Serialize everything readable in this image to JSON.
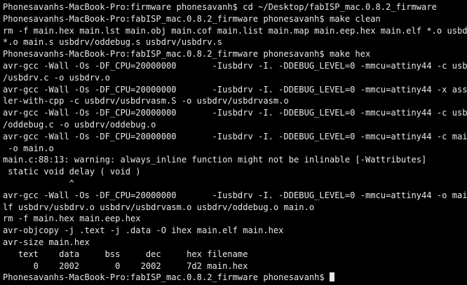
{
  "terminal": {
    "lines": [
      "Phonesavanhs-MacBook-Pro:firmware phonesavanh$ cd ~/Desktop/fabISP_mac.0.8.2_firmware",
      "Phonesavanhs-MacBook-Pro:fabISP_mac.0.8.2_firmware phonesavanh$ make clean",
      "rm -f main.hex main.lst main.obj main.cof main.list main.map main.eep.hex main.elf *.o usbdrv/",
      "*.o main.s usbdrv/oddebug.s usbdrv/usbdrv.s",
      "Phonesavanhs-MacBook-Pro:fabISP_mac.0.8.2_firmware phonesavanh$ make hex",
      "avr-gcc -Wall -Os -DF_CPU=20000000       -Iusbdrv -I. -DDEBUG_LEVEL=0 -mmcu=attiny44 -c usbdrv",
      "/usbdrv.c -o usbdrv.o",
      "avr-gcc -Wall -Os -DF_CPU=20000000       -Iusbdrv -I. -DDEBUG_LEVEL=0 -mmcu=attiny44 -x assemb",
      "ler-with-cpp -c usbdrv/usbdrvasm.S -o usbdrv/usbdrvasm.o",
      "avr-gcc -Wall -Os -DF_CPU=20000000       -Iusbdrv -I. -DDEBUG_LEVEL=0 -mmcu=attiny44 -c usbdrv",
      "/oddebug.c -o usbdrv/oddebug.o",
      "avr-gcc -Wall -Os -DF_CPU=20000000       -Iusbdrv -I. -DDEBUG_LEVEL=0 -mmcu=attiny44 -c main.c",
      " -o main.o",
      "main.c:88:13: warning: always_inline function might not be inlinable [-Wattributes]",
      " static void delay ( void )",
      "             ^",
      "avr-gcc -Wall -Os -DF_CPU=20000000       -Iusbdrv -I. -DDEBUG_LEVEL=0 -mmcu=attiny44 -o main.e",
      "lf usbdrv/usbdrv.o usbdrv/usbdrvasm.o usbdrv/oddebug.o main.o",
      "rm -f main.hex main.eep.hex",
      "avr-objcopy -j .text -j .data -O ihex main.elf main.hex",
      "avr-size main.hex",
      "   text    data     bss     dec     hex filename",
      "      0    2002       0    2002     7d2 main.hex",
      "Phonesavanhs-MacBook-Pro:fabISP_mac.0.8.2_firmware phonesavanh$ "
    ]
  }
}
